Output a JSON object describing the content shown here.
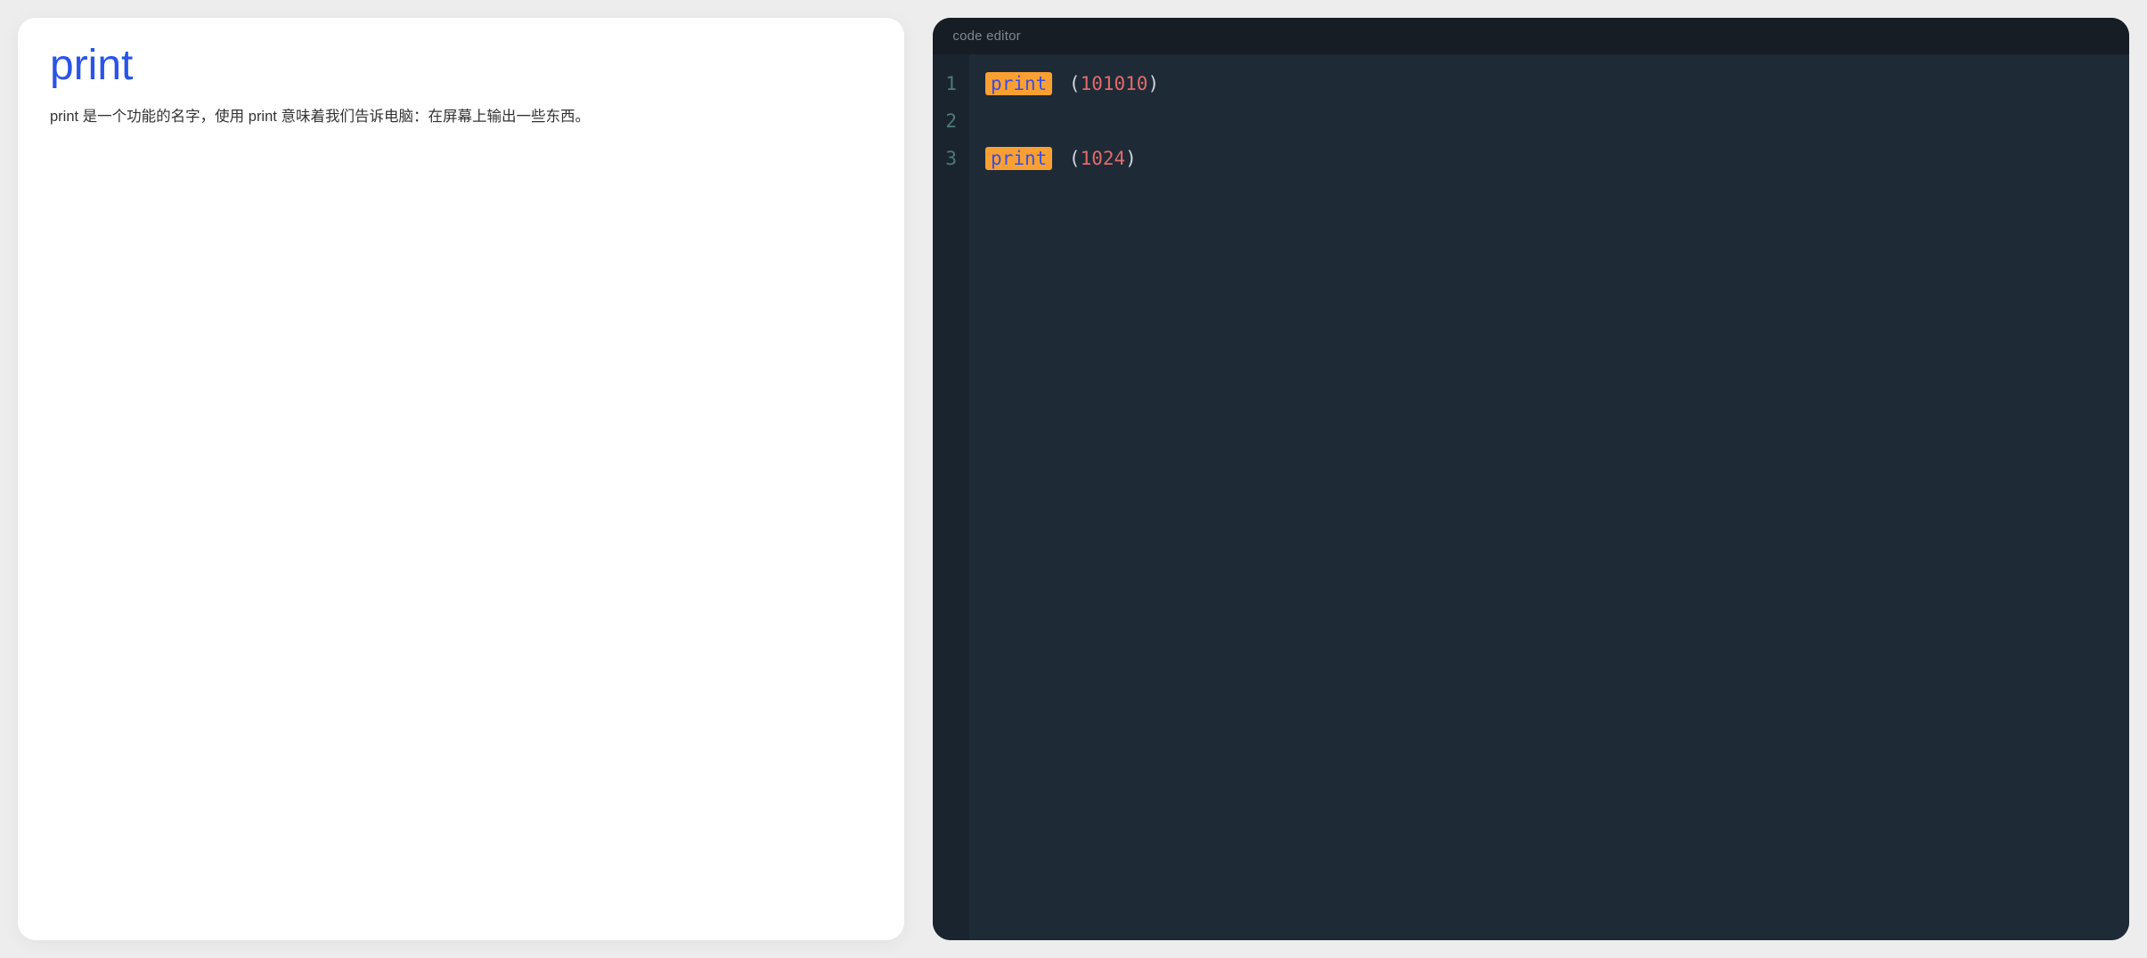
{
  "doc": {
    "title": "print",
    "description": "print 是一个功能的名字，使用 print 意味着我们告诉电脑：在屏幕上输出一些东西。"
  },
  "editor": {
    "title": "code editor",
    "tokens": {
      "print_keyword": "print",
      "open_paren": "(",
      "close_paren": ")"
    },
    "lines": [
      {
        "number": "1",
        "fn": "print",
        "arg": "101010"
      },
      {
        "number": "2"
      },
      {
        "number": "3",
        "fn": "print",
        "arg": "1024"
      }
    ]
  }
}
